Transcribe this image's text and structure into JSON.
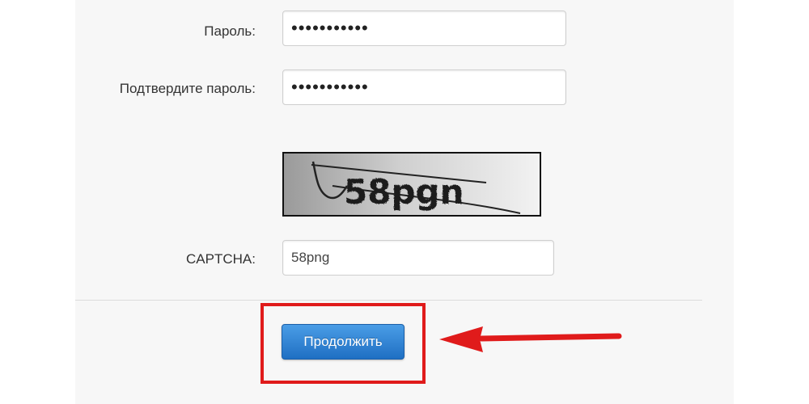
{
  "form": {
    "password_label": "Пароль:",
    "password_value": "•••••••••••",
    "confirm_label": "Подтвердите пароль:",
    "confirm_value": "•••••••••••",
    "captcha_image_text": "58pgn",
    "captcha_label": "CAPTCHA:",
    "captcha_value": "58png",
    "continue_label": "Продолжить"
  },
  "colors": {
    "button_blue": "#1f6fc3",
    "highlight_red": "#e01b1b"
  },
  "annotations": {
    "highlight": "red-rectangle",
    "pointer": "red-arrow-left"
  }
}
